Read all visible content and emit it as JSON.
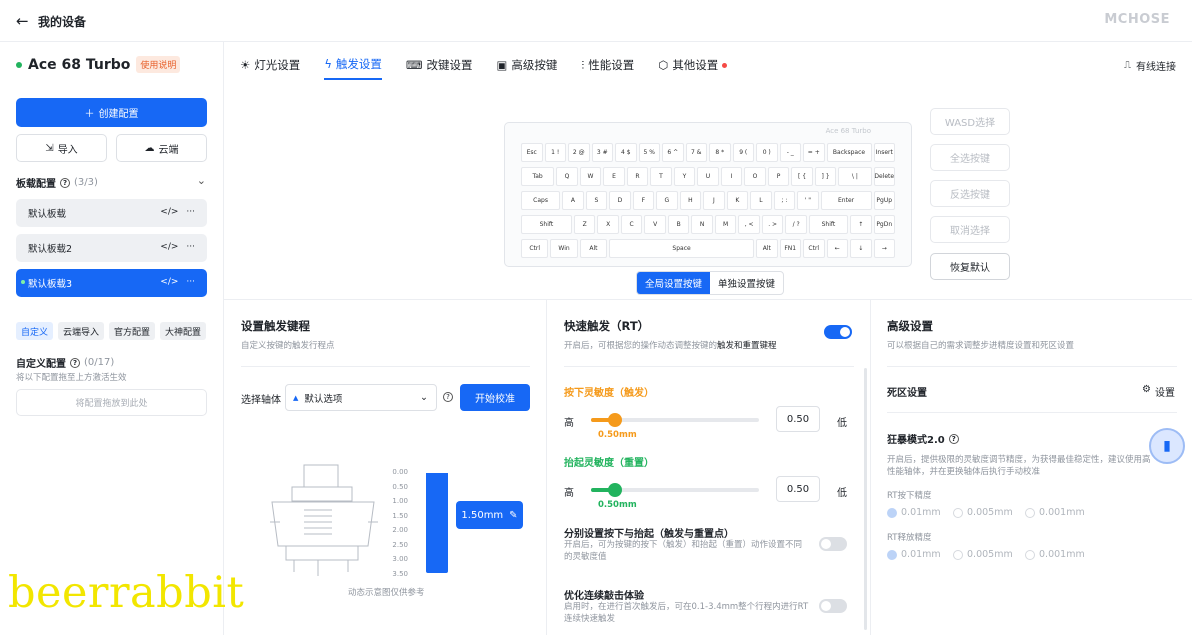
{
  "header": {
    "back": "←",
    "title": "我的设备",
    "brand": "MCHOSE"
  },
  "sidebar": {
    "device_name": "Ace 68 Turbo",
    "manual": "使用说明",
    "create": "创建配置",
    "import": "导入",
    "cloud": "云端",
    "board_config": "板载配置",
    "board_count": "(3/3)",
    "boards": [
      {
        "name": "默认板载"
      },
      {
        "name": "默认板载2"
      },
      {
        "name": "默认板载3"
      }
    ],
    "action_code": "</>",
    "action_more": "···",
    "tags": [
      "自定义",
      "云端导入",
      "官方配置",
      "大神配置"
    ],
    "custom_title": "自定义配置",
    "custom_count": "(0/17)",
    "custom_desc": "将以下配置拖至上方激活生效",
    "drop": "将配置拖放到此处"
  },
  "tabs": [
    {
      "label": "灯光设置",
      "icon": "bulb-icon"
    },
    {
      "label": "触发设置",
      "icon": "bolt-icon"
    },
    {
      "label": "改键设置",
      "icon": "keyboard-icon"
    },
    {
      "label": "高级按键",
      "icon": "key-icon"
    },
    {
      "label": "性能设置",
      "icon": "sliders-icon"
    },
    {
      "label": "其他设置",
      "icon": "hex-icon"
    }
  ],
  "connection": "有线连接",
  "keyboard": {
    "title": "Ace 68 Turbo"
  },
  "key_rows": [
    [
      "Esc",
      "1 !",
      "2 @",
      "3 #",
      "4 $",
      "5 %",
      "6 ^",
      "7 &",
      "8 *",
      "9 (",
      "0 )",
      "- _",
      "= +",
      "Backspace",
      "Insert"
    ],
    [
      "Tab",
      "Q",
      "W",
      "E",
      "R",
      "T",
      "Y",
      "U",
      "I",
      "O",
      "P",
      "[ {",
      "] }",
      "\\ |",
      "Delete"
    ],
    [
      "Caps",
      "A",
      "S",
      "D",
      "F",
      "G",
      "H",
      "J",
      "K",
      "L",
      "; :",
      "' \"",
      "Enter",
      "PgUp"
    ],
    [
      "Shift",
      "Z",
      "X",
      "C",
      "V",
      "B",
      "N",
      "M",
      ", <",
      ". >",
      "/ ?",
      "Shift",
      "↑",
      "PgDn"
    ],
    [
      "Ctrl",
      "Win",
      "Alt",
      "Space",
      "Alt",
      "FN1",
      "Ctrl",
      "←",
      "↓",
      "→"
    ]
  ],
  "right_buttons": [
    "WASD选择",
    "全选按键",
    "反选按键",
    "取消选择",
    "恢复默认"
  ],
  "segment": [
    "全局设置按键",
    "单独设置按键"
  ],
  "trigger": {
    "title": "设置触发键程",
    "desc": "自定义按键的触发行程点",
    "axis_label": "选择轴体",
    "axis_value": "默认选项",
    "calibrate": "开始校准",
    "scale": [
      "0.00",
      "0.50",
      "1.00",
      "1.50",
      "2.00",
      "2.50",
      "3.00",
      "3.50"
    ],
    "value": "1.50mm",
    "value_num": 1.5,
    "max": 3.5,
    "caption": "动态示意图仅供参考"
  },
  "rt": {
    "title": "快速触发（RT）",
    "desc_pre": "开启后，可根据您的操作动态调整按键的",
    "desc_bold": "触发和重置键程",
    "enabled": true,
    "press_title": "按下灵敏度（触发）",
    "press_value": "0.50",
    "press_label": "0.50mm",
    "lift_title": "抬起灵敏度（重置）",
    "lift_value": "0.50",
    "lift_label": "0.50mm",
    "high": "高",
    "low": "低",
    "split_title": "分别设置按下与抬起（触发与重置点）",
    "split_desc": "开启后，可为按键的按下（触发）和抬起（重置）动作设置不同的灵敏度值",
    "opt_title": "优化连续敲击体验",
    "opt_desc": "启用时，在进行首次触发后，可在0.1-3.4mm整个行程内进行RT连续快速触发"
  },
  "advanced": {
    "title": "高级设置",
    "desc": "可以根据自己的需求调整步进精度设置和死区设置",
    "deadzone": "死区设置",
    "settings": "设置",
    "rage": "狂暴模式2.0",
    "rage_desc": "开启后，提供极限的灵敏度调节精度，为获得最佳稳定性，建议使用高性能轴体，并在更换轴体后执行手动校准",
    "rt_press": "RT按下精度",
    "rt_release": "RT释放精度",
    "opts": [
      "0.01mm",
      "0.005mm",
      "0.001mm"
    ]
  },
  "watermark": "beerrabbit",
  "colors": {
    "accent": "#1768f5",
    "orange": "#f59a1b",
    "green": "#22b35e"
  }
}
